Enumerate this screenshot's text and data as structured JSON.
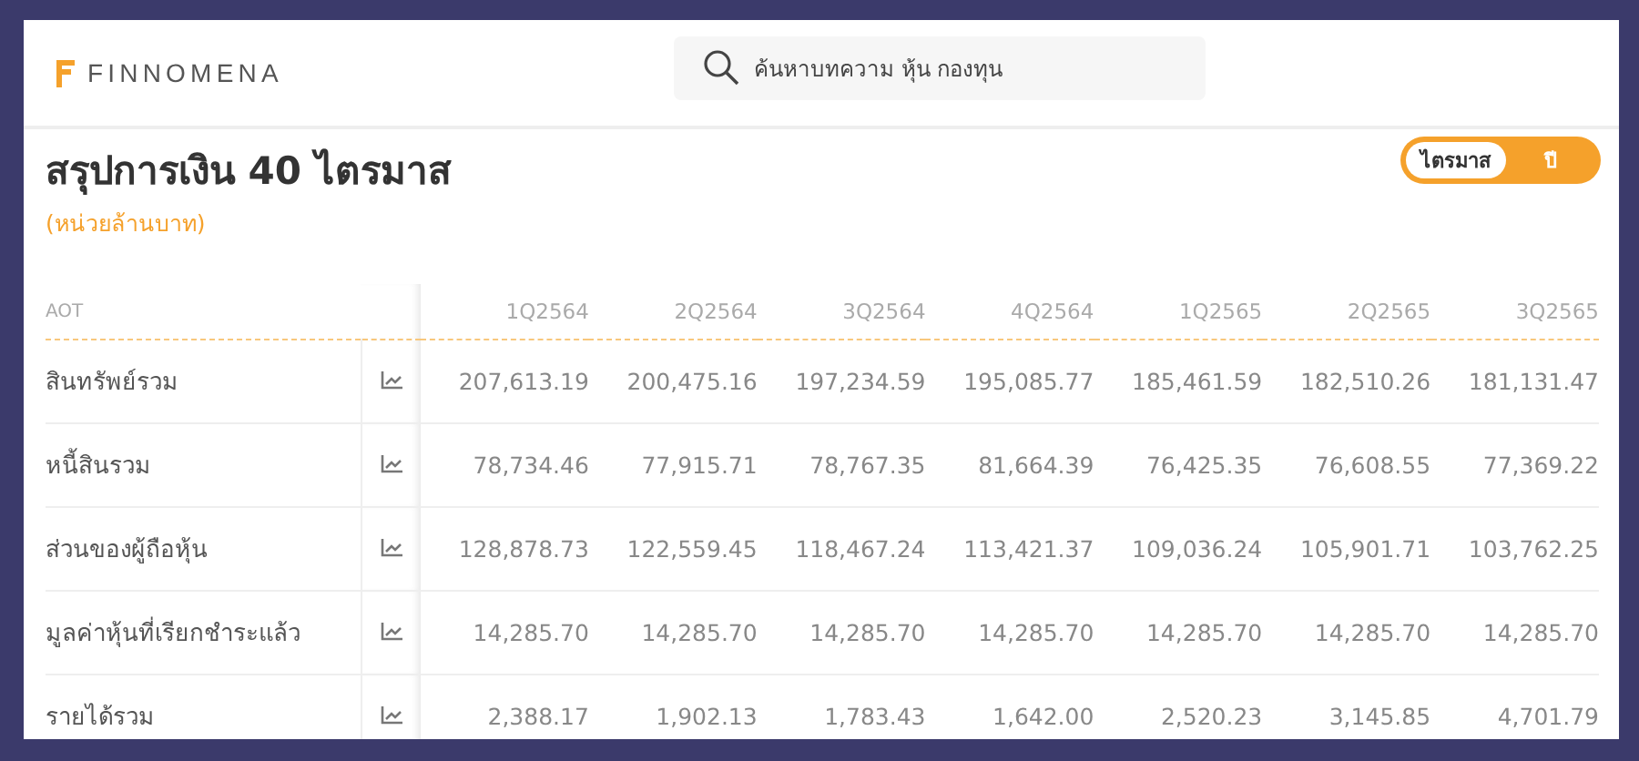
{
  "header": {
    "logo_text": "FINNOMENA",
    "search": {
      "placeholder": "ค้นหาบทความ หุ้น กองทุน"
    }
  },
  "title": "สรุปการเงิน 40 ไตรมาส",
  "unit": "(หน่วยล้านบาท)",
  "period_toggle": [
    {
      "label": "ไตรมาส",
      "selected": true
    },
    {
      "label": "ปี",
      "selected": false
    }
  ],
  "table": {
    "symbol": "AOT",
    "columns": [
      "1Q2564",
      "2Q2564",
      "3Q2564",
      "4Q2564",
      "1Q2565",
      "2Q2565",
      "3Q2565"
    ],
    "rows": [
      {
        "label": "สินทรัพย์รวม",
        "values": [
          "207,613.19",
          "200,475.16",
          "197,234.59",
          "195,085.77",
          "185,461.59",
          "182,510.26",
          "181,131.47"
        ]
      },
      {
        "label": "หนี้สินรวม",
        "values": [
          "78,734.46",
          "77,915.71",
          "78,767.35",
          "81,664.39",
          "76,425.35",
          "76,608.55",
          "77,369.22"
        ]
      },
      {
        "label": "ส่วนของผู้ถือหุ้น",
        "values": [
          "128,878.73",
          "122,559.45",
          "118,467.24",
          "113,421.37",
          "109,036.24",
          "105,901.71",
          "103,762.25"
        ]
      },
      {
        "label": "มูลค่าหุ้นที่เรียกชำระแล้ว",
        "values": [
          "14,285.70",
          "14,285.70",
          "14,285.70",
          "14,285.70",
          "14,285.70",
          "14,285.70",
          "14,285.70"
        ]
      },
      {
        "label": "รายได้รวม",
        "values": [
          "2,388.17",
          "1,902.13",
          "1,783.43",
          "1,642.00",
          "2,520.23",
          "3,145.85",
          "4,701.79"
        ]
      }
    ]
  }
}
